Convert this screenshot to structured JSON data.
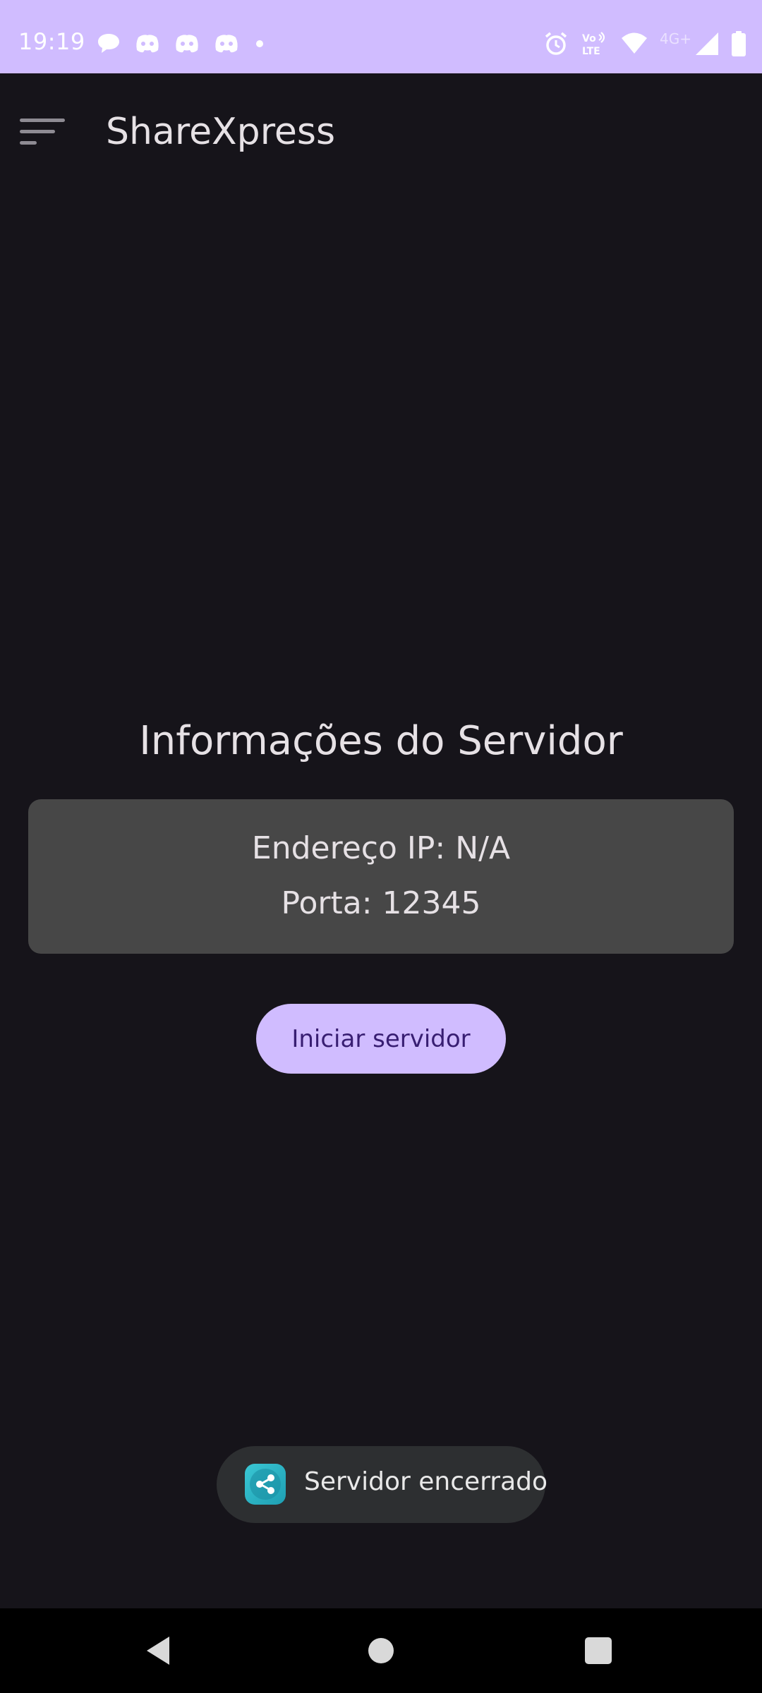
{
  "status_bar": {
    "time": "19:19",
    "background": "#d0bcff",
    "network_label": "4G+",
    "volte_label_top": "Vo",
    "volte_label_bottom": "LTE",
    "left_icons": [
      "chat-bubble-icon",
      "discord-icon",
      "discord-icon",
      "discord-icon",
      "dot-icon"
    ],
    "right_icons": [
      "alarm-icon",
      "volte-icon",
      "wifi-icon",
      "signal-icon",
      "battery-icon"
    ]
  },
  "app_bar": {
    "title": "ShareXpress",
    "menu_icon": "menu-icon"
  },
  "main": {
    "section_title": "Informações do Servidor",
    "ip_text": "Endereço IP: N/A",
    "port_text": "Porta: 12345",
    "start_button_label": "Iniciar servidor"
  },
  "toast": {
    "text": "Servidor encerrado",
    "icon": "share-icon"
  },
  "nav_bar": {
    "icons": [
      "back-icon",
      "home-icon",
      "recents-icon"
    ]
  },
  "colors": {
    "background": "#16141a",
    "accent": "#d0bcff",
    "card": "#474747",
    "text": "#e6e1e5",
    "button_text": "#381e72",
    "toast_bg": "#2d2f31",
    "toast_icon": "#22b0c4"
  }
}
